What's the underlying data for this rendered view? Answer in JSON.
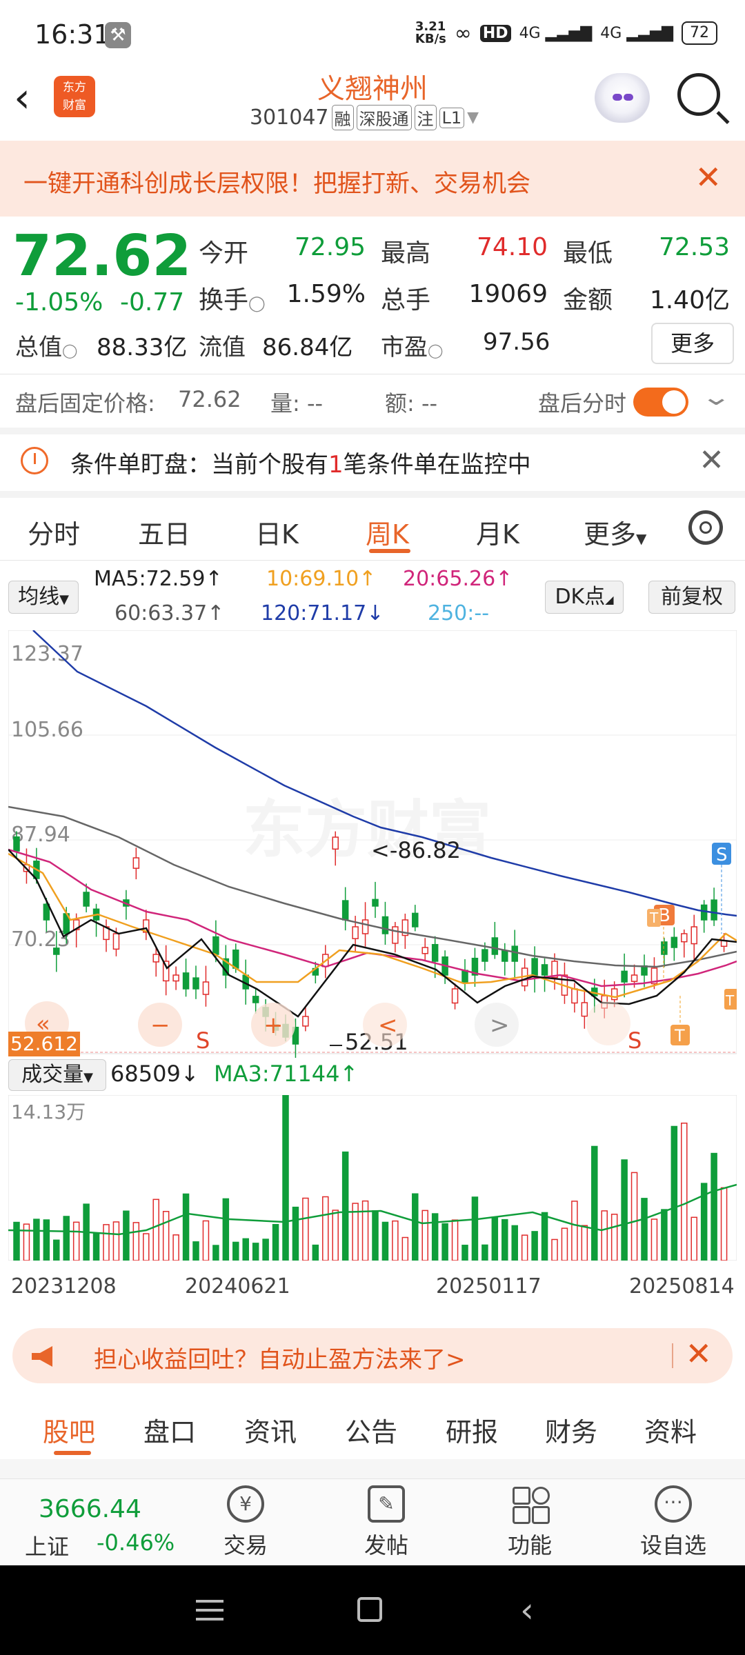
{
  "status_bar": {
    "time": "16:31",
    "net_speed": "3.21\nKB/s",
    "hd": "HD",
    "sig1": "4G",
    "sig2": "4G",
    "battery": "72"
  },
  "header": {
    "logo": "东方\n财富",
    "title": "义翘神州",
    "code": "301047",
    "tags": [
      "融",
      "深股通",
      "注",
      "L1"
    ]
  },
  "banner": {
    "text": "一键开通科创成长层权限！把握打新、交易机会"
  },
  "quote": {
    "price": "72.62",
    "pct": "-1.05%",
    "chg": "-0.77",
    "open_label": "今开",
    "open": "72.95",
    "high_label": "最高",
    "high": "74.10",
    "low_label": "最低",
    "low": "72.53",
    "turnover_label": "换手",
    "turnover": "1.59%",
    "vol_label": "总手",
    "vol": "19069",
    "amount_label": "金额",
    "amount": "1.40亿",
    "mcap_label": "总值",
    "mcap": "88.33亿",
    "float_label": "流值",
    "float": "86.84亿",
    "pe_label": "市盈",
    "pe": "97.56",
    "more": "更多"
  },
  "post_trade": {
    "label": "盘后固定价格:",
    "price": "72.62",
    "vol_label": "量:",
    "vol": "--",
    "amt_label": "额:",
    "amt": "--",
    "toggle_label": "盘后分时"
  },
  "condition": {
    "pre": "条件单盯盘：当前个股有",
    "num": "1",
    "post": "笔条件单在监控中"
  },
  "tabs": [
    "分时",
    "五日",
    "日K",
    "周K",
    "月K",
    "更多"
  ],
  "active_tab": "周K",
  "ma": {
    "select": "均线",
    "ma5": "MA5:72.59",
    "ma10": "10:69.10",
    "ma20": "20:65.26",
    "ma60": "60:63.37",
    "ma120": "120:71.17",
    "ma250": "250:--",
    "dk": "DK点",
    "fq": "前复权",
    "arrow_up": "↑",
    "arrow_down": "↓"
  },
  "chart": {
    "y_labels": [
      "123.37",
      "105.66",
      "87.94",
      "70.23"
    ],
    "min_badge": "52.612",
    "hi_annot": "<-86.82",
    "lo_annot": "52.51",
    "vol_select": "成交量",
    "vol_value": "68509",
    "vol_arrow": "↓",
    "ma3": "MA3:71144",
    "ma3_arrow": "↑",
    "vol_max": "14.13万",
    "x_labels": [
      "20231208",
      "20240621",
      "20250117",
      "20250814"
    ],
    "markers": [
      "S",
      "S",
      "S",
      "B",
      "T",
      "T",
      "T"
    ],
    "controls": {
      "left": "«",
      "minus": "−",
      "plus": "+",
      "prev": "<",
      "next": ">"
    }
  },
  "ad": {
    "text": "担心收益回吐？自动止盈方法来了>"
  },
  "bottom_tabs": [
    "股吧",
    "盘口",
    "资讯",
    "公告",
    "研报",
    "财务",
    "资料"
  ],
  "active_bottom_tab": "股吧",
  "index": {
    "value": "3666.44",
    "name": "上证",
    "pct": "-0.46%"
  },
  "nav": [
    "交易",
    "发帖",
    "功能",
    "设自选"
  ],
  "colors": {
    "up": "#e02b2b",
    "down": "#0f9d3a",
    "accent": "#e8652a"
  }
}
